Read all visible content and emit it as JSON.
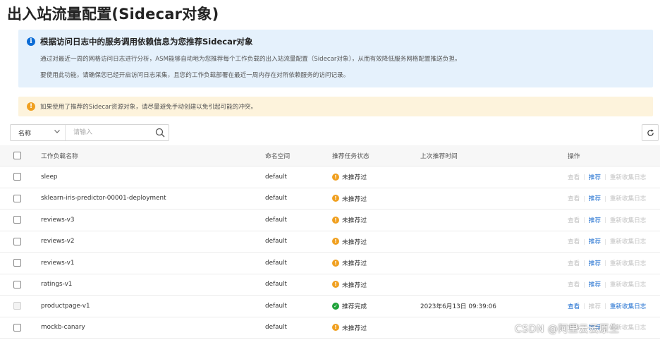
{
  "page": {
    "title": "出入站流量配置(Sidecar对象)"
  },
  "info": {
    "title": "根据访问日志中的服务调用依赖信息为您推荐Sidecar对象",
    "line1": "通过对最近一周的网格访问日志进行分析，ASM能够自动地为您推荐每个工作负载的出入站流量配置（Sidecar对象），从而有效降低服务网格配置推送负担。",
    "line2": "要使用此功能，请确保您已经开启访问日志采集，且您的工作负载部署在最近一周内存在对所依赖服务的访问记录。",
    "icon": "info-icon"
  },
  "warning": {
    "text": "如果使用了推荐的Sidecar资源对象，请尽量避免手动创建以免引起可能的冲突。",
    "icon": "warning-icon"
  },
  "toolbar": {
    "filter_label": "名称",
    "search_placeholder": "请输入",
    "search_icon": "search-icon",
    "refresh_icon": "refresh-icon"
  },
  "table": {
    "headers": {
      "name": "工作负载名称",
      "namespace": "命名空间",
      "status": "推荐任务状态",
      "last_time": "上次推荐时间",
      "ops": "操作"
    },
    "ops_labels": {
      "view": "查看",
      "recommend": "推荐",
      "recollect": "重新收集日志"
    },
    "rows": [
      {
        "name": "sleep",
        "namespace": "default",
        "status": "未推荐过",
        "state": "warn",
        "last_time": ""
      },
      {
        "name": "sklearn-iris-predictor-00001-deployment",
        "namespace": "default",
        "status": "未推荐过",
        "state": "warn",
        "last_time": ""
      },
      {
        "name": "reviews-v3",
        "namespace": "default",
        "status": "未推荐过",
        "state": "warn",
        "last_time": ""
      },
      {
        "name": "reviews-v2",
        "namespace": "default",
        "status": "未推荐过",
        "state": "warn",
        "last_time": ""
      },
      {
        "name": "reviews-v1",
        "namespace": "default",
        "status": "未推荐过",
        "state": "warn",
        "last_time": ""
      },
      {
        "name": "ratings-v1",
        "namespace": "default",
        "status": "未推荐过",
        "state": "warn",
        "last_time": ""
      },
      {
        "name": "productpage-v1",
        "namespace": "default",
        "status": "推荐完成",
        "state": "ok",
        "last_time": "2023年6月13日 09:39:06"
      },
      {
        "name": "mockb-canary",
        "namespace": "default",
        "status": "未推荐过",
        "state": "warn",
        "last_time": ""
      }
    ]
  },
  "watermark": "CSDN @阿里云云原生",
  "colors": {
    "info_bg": "#e5f1fc",
    "warn_bg": "#fdf3dc",
    "link": "#1f6fd0",
    "warn": "#f0a020",
    "ok": "#1fa33a"
  }
}
